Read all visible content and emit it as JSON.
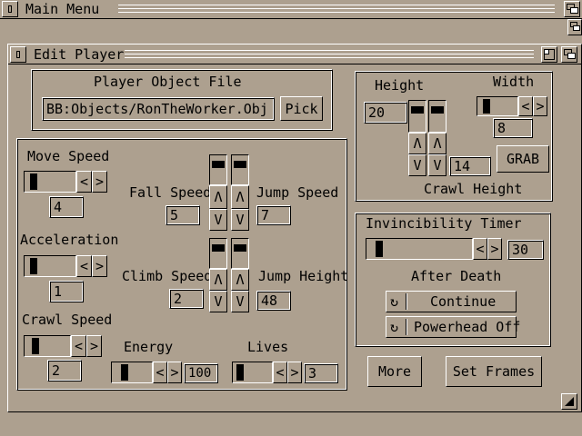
{
  "screen": {
    "title": "Main Menu"
  },
  "window": {
    "title": "Edit Player",
    "object_file": {
      "title": "Player Object File",
      "path": "BB:Objects/RonTheWorker.Obj",
      "pick_label": "Pick"
    },
    "move_speed": {
      "label": "Move Speed",
      "value": "4"
    },
    "acceleration": {
      "label": "Acceleration",
      "value": "1"
    },
    "crawl_speed": {
      "label": "Crawl Speed",
      "value": "2"
    },
    "fall_speed": {
      "label": "Fall Speed",
      "value": "5"
    },
    "jump_speed": {
      "label": "Jump Speed",
      "value": "7"
    },
    "climb_speed": {
      "label": "Climb Speed",
      "value": "2"
    },
    "jump_height": {
      "label": "Jump Height",
      "value": "48"
    },
    "energy": {
      "label": "Energy",
      "value": "100"
    },
    "lives": {
      "label": "Lives",
      "value": "3"
    },
    "height": {
      "label": "Height",
      "value": "20"
    },
    "width": {
      "label": "Width",
      "value": "8"
    },
    "crawl_height": {
      "label": "Crawl Height",
      "value": "14"
    },
    "grab_label": "GRAB",
    "invincibility": {
      "label": "Invincibility Timer",
      "value": "30"
    },
    "after_death": {
      "label": "After Death",
      "continue_label": "Continue",
      "powerhead_label": "Powerhead Off"
    },
    "more_label": "More",
    "set_frames_label": "Set Frames",
    "glyphs": {
      "left": "<",
      "right": ">",
      "up": "Λ",
      "down": "V",
      "cycle": "↻",
      "minus": "−"
    }
  }
}
